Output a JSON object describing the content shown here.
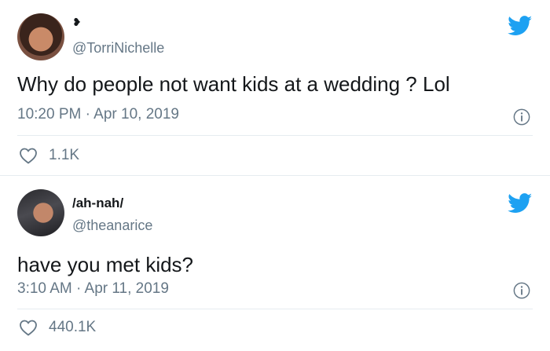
{
  "tweets": [
    {
      "display_name": "❥",
      "handle": "@TorriNichelle",
      "text": "Why do people not want kids at a wedding ? Lol",
      "timestamp": "10:20 PM · Apr 10, 2019",
      "likes": "1.1K"
    },
    {
      "display_name": "/ah-nah/",
      "handle": "@theanarice",
      "text": "have you met kids?",
      "timestamp": "3:10 AM · Apr 11, 2019",
      "likes": "440.1K"
    }
  ],
  "icons": {
    "brand": "twitter-bird-icon",
    "info": "info-icon",
    "like": "heart-icon"
  },
  "colors": {
    "twitter_blue": "#1da1f2",
    "secondary_text": "#657786",
    "divider": "#e6ecf0"
  }
}
